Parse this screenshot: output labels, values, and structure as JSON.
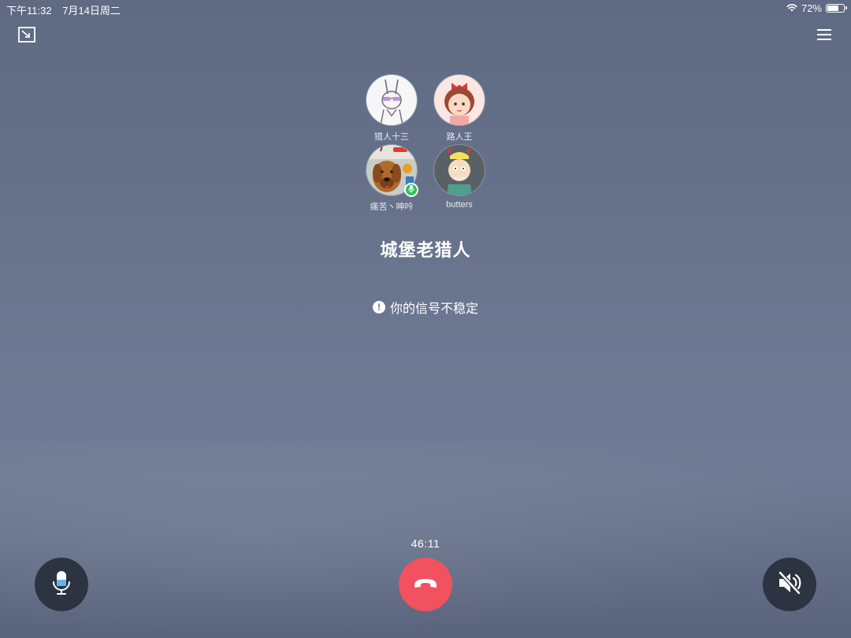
{
  "status_bar": {
    "time": "下午11:32",
    "date": "7月14日周二",
    "battery_text": "72%",
    "battery_level": 0.72
  },
  "icons": {
    "minimize": "minimize-window-icon",
    "menu": "menu-icon",
    "wifi": "wifi-icon",
    "battery": "battery-icon",
    "warning": "warning-icon",
    "mic": "microphone-icon",
    "hangup": "hang-up-icon",
    "speaker_muted": "speaker-muted-icon"
  },
  "participants": [
    {
      "name": "猎人十三",
      "avatar": "bunny-sketch-avatar",
      "speaking": false
    },
    {
      "name": "路人王",
      "avatar": "cartoon-girl-avatar",
      "speaking": false
    },
    {
      "name": "痛苦丶呻吟",
      "avatar": "dog-photo-avatar",
      "speaking": true
    },
    {
      "name": "butters",
      "avatar": "butters-cartoon-avatar",
      "speaking": false
    }
  ],
  "call": {
    "group_name": "城堡老猎人",
    "warning_text": "你的信号不稳定",
    "duration": "46:11"
  },
  "colors": {
    "hangup": "#f2515f",
    "control_dark": "#2c3341",
    "speaking_badge": "#2ec25b",
    "mic_accent": "#5fb6f2"
  }
}
